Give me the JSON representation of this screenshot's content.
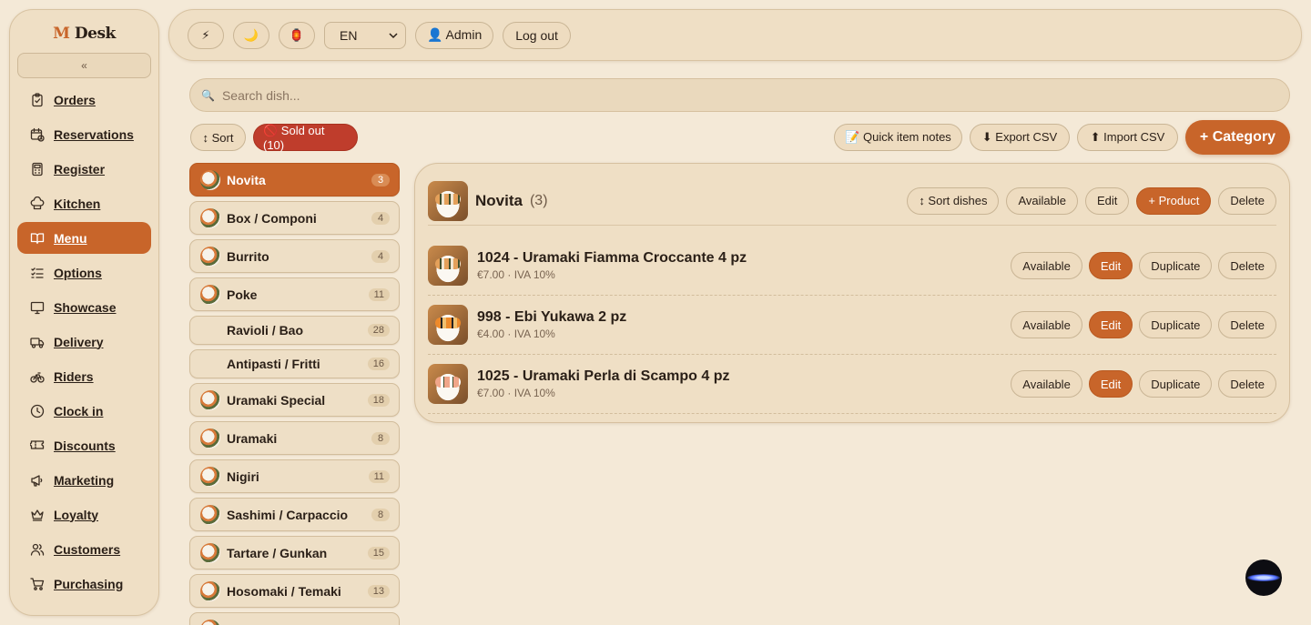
{
  "sidebar": {
    "logo_m": "M",
    "logo_text": "Desk",
    "collapse_label": "«",
    "items": [
      {
        "label": "Orders",
        "icon": "clipboard-icon"
      },
      {
        "label": "Reservations",
        "icon": "calendar-clock-icon"
      },
      {
        "label": "Register",
        "icon": "calculator-icon"
      },
      {
        "label": "Kitchen",
        "icon": "chef-hat-icon"
      },
      {
        "label": "Menu",
        "icon": "book-open-icon",
        "active": true
      },
      {
        "label": "Options",
        "icon": "list-checks-icon"
      },
      {
        "label": "Showcase",
        "icon": "monitor-icon"
      },
      {
        "label": "Delivery",
        "icon": "truck-icon"
      },
      {
        "label": "Riders",
        "icon": "bike-icon"
      },
      {
        "label": "Clock in",
        "icon": "clock-icon"
      },
      {
        "label": "Discounts",
        "icon": "ticket-icon"
      },
      {
        "label": "Marketing",
        "icon": "megaphone-icon"
      },
      {
        "label": "Loyalty",
        "icon": "crown-icon"
      },
      {
        "label": "Customers",
        "icon": "users-icon"
      },
      {
        "label": "Purchasing",
        "icon": "cart-icon"
      }
    ]
  },
  "topbar": {
    "lightning": "⚡",
    "moon": "🌙",
    "lantern": "🏮",
    "lang": "EN",
    "admin": "👤 Admin",
    "logout": "Log out"
  },
  "search": {
    "icon": "🔍",
    "placeholder": "Search dish..."
  },
  "toolbar": {
    "sort": "↕ Sort",
    "sold_out": "🚫 Sold out (10)",
    "quick_notes": "📝 Quick item notes",
    "export_csv": "⬇ Export CSV",
    "import_csv": "⬆ Import CSV",
    "add_category": "+ Category"
  },
  "categories": [
    {
      "name": "Novita",
      "count": "3",
      "active": true,
      "thumb": true
    },
    {
      "name": "Box / Componi",
      "count": "4",
      "thumb": true
    },
    {
      "name": "Burrito",
      "count": "4",
      "thumb": true
    },
    {
      "name": "Poke",
      "count": "11",
      "thumb": true
    },
    {
      "name": "Ravioli / Bao",
      "count": "28",
      "thumb": false
    },
    {
      "name": "Antipasti / Fritti",
      "count": "16",
      "thumb": false
    },
    {
      "name": "Uramaki Special",
      "count": "18",
      "thumb": true
    },
    {
      "name": "Uramaki",
      "count": "8",
      "thumb": true
    },
    {
      "name": "Nigiri",
      "count": "11",
      "thumb": true
    },
    {
      "name": "Sashimi / Carpaccio",
      "count": "8",
      "thumb": true
    },
    {
      "name": "Tartare / Gunkan",
      "count": "15",
      "thumb": true
    },
    {
      "name": "Hosomaki / Temaki",
      "count": "13",
      "thumb": true
    }
  ],
  "panel": {
    "title": "Novita",
    "count": "(3)",
    "actions": {
      "sort_dishes": "↕ Sort dishes",
      "available": "Available",
      "edit": "Edit",
      "add_product": "+ Product",
      "delete": "Delete"
    },
    "products": [
      {
        "name": "1024 - Uramaki Fiamma Croccante 4 pz",
        "meta": "€7.00 · IVA 10%",
        "img": ""
      },
      {
        "name": "998 - Ebi Yukawa 2 pz",
        "meta": "€4.00 · IVA 10%",
        "img": "orange"
      },
      {
        "name": "1025 - Uramaki Perla di Scampo 4 pz",
        "meta": "€7.00 · IVA 10%",
        "img": "pink"
      }
    ],
    "product_actions": {
      "available": "Available",
      "edit": "Edit",
      "duplicate": "Duplicate",
      "delete": "Delete"
    }
  },
  "colors": {
    "accent": "#c8652a",
    "sold_out": "#bf3d2c",
    "background": "#f4e9d7"
  }
}
